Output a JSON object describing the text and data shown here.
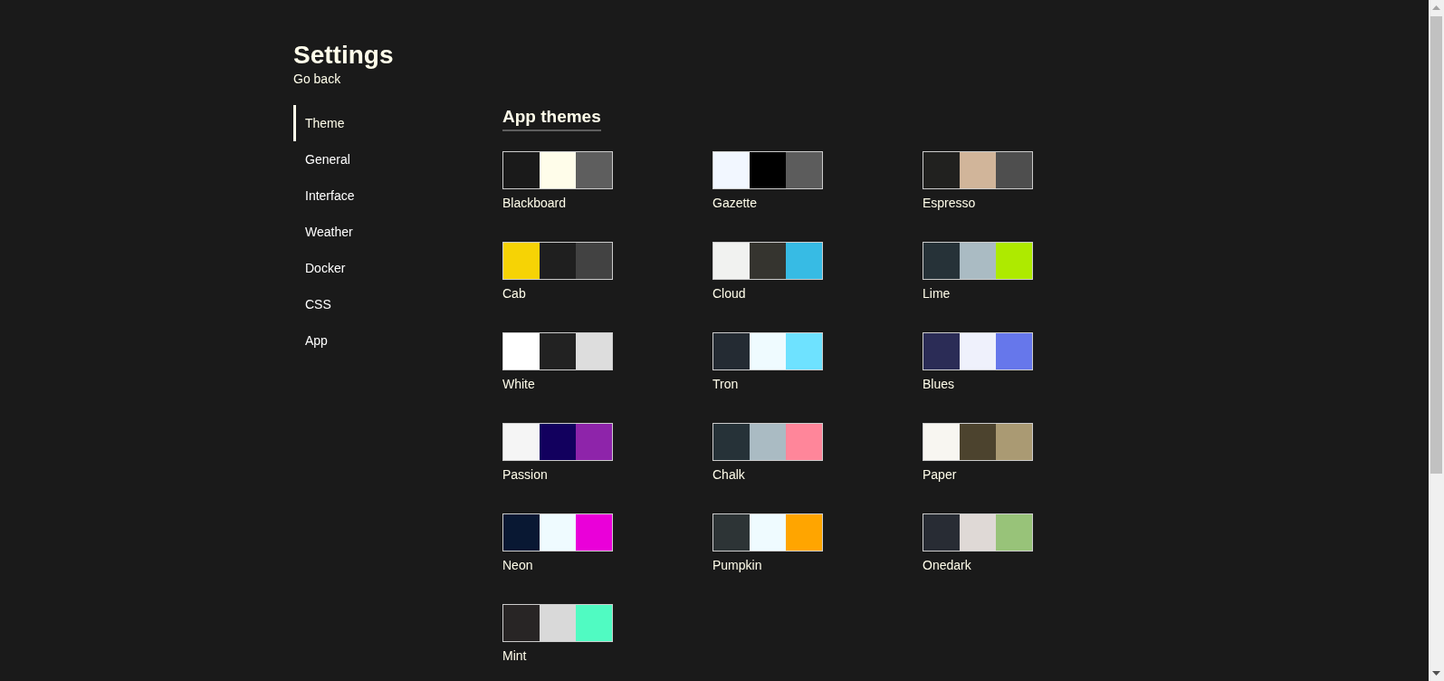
{
  "header": {
    "title": "Settings",
    "back_link": "Go back"
  },
  "sidebar": {
    "items": [
      {
        "label": "Theme",
        "selected": true
      },
      {
        "label": "General",
        "selected": false
      },
      {
        "label": "Interface",
        "selected": false
      },
      {
        "label": "Weather",
        "selected": false
      },
      {
        "label": "Docker",
        "selected": false
      },
      {
        "label": "CSS",
        "selected": false
      },
      {
        "label": "App",
        "selected": false
      }
    ]
  },
  "section": {
    "title": "App themes",
    "themes": [
      {
        "name": "Blackboard",
        "swatches": [
          {
            "color": "#1a1a1a"
          },
          {
            "color": "#fffdea"
          },
          {
            "color": "#5e5e5e"
          }
        ]
      },
      {
        "name": "Gazette",
        "swatches": [
          {
            "color": "#f2f7ff"
          },
          {
            "color": "#000000"
          },
          {
            "color": "#5c5c5c"
          }
        ]
      },
      {
        "name": "Espresso",
        "swatches": [
          {
            "color": "#21211f"
          },
          {
            "color": "#d1b59a"
          },
          {
            "color": "#4e4e4e"
          }
        ]
      },
      {
        "name": "Cab",
        "swatches": [
          {
            "color": "#f6d305"
          },
          {
            "color": "#1f1f1f"
          },
          {
            "color": "#424242"
          }
        ]
      },
      {
        "name": "Cloud",
        "swatches": [
          {
            "color": "#f1f2f0"
          },
          {
            "color": "#35342f"
          },
          {
            "color": "#37bbe4"
          }
        ]
      },
      {
        "name": "Lime",
        "swatches": [
          {
            "color": "#263238"
          },
          {
            "color": "#aabbc3"
          },
          {
            "color": "#aeea00"
          }
        ]
      },
      {
        "name": "White",
        "swatches": [
          {
            "color": "#ffffff"
          },
          {
            "color": "#222222"
          },
          {
            "color": "#dddddd"
          }
        ]
      },
      {
        "name": "Tron",
        "swatches": [
          {
            "color": "#242b33"
          },
          {
            "color": "#effbff"
          },
          {
            "color": "#6ee2ff"
          }
        ]
      },
      {
        "name": "Blues",
        "swatches": [
          {
            "color": "#2b2c56"
          },
          {
            "color": "#eff1fc"
          },
          {
            "color": "#6677eb"
          }
        ]
      },
      {
        "name": "Passion",
        "swatches": [
          {
            "color": "#f5f5f5"
          },
          {
            "color": "#12005e"
          },
          {
            "color": "#8e24aa"
          }
        ]
      },
      {
        "name": "Chalk",
        "swatches": [
          {
            "color": "#263238"
          },
          {
            "color": "#aabbc3"
          },
          {
            "color": "#ff869a"
          }
        ]
      },
      {
        "name": "Paper",
        "swatches": [
          {
            "color": "#f8f6f1"
          },
          {
            "color": "#4c432e"
          },
          {
            "color": "#aa9a73"
          }
        ]
      },
      {
        "name": "Neon",
        "swatches": [
          {
            "color": "#091833"
          },
          {
            "color": "#effbff"
          },
          {
            "color": "#ea00d9"
          }
        ]
      },
      {
        "name": "Pumpkin",
        "swatches": [
          {
            "color": "#2d3436"
          },
          {
            "color": "#effbff"
          },
          {
            "color": "#ffa500"
          }
        ]
      },
      {
        "name": "Onedark",
        "swatches": [
          {
            "color": "#282c34"
          },
          {
            "color": "#dfd9d6"
          },
          {
            "color": "#98c379"
          }
        ]
      },
      {
        "name": "Mint",
        "swatches": [
          {
            "color": "#282525"
          },
          {
            "color": "#d9d9d9"
          },
          {
            "color": "#50fbc2"
          }
        ]
      }
    ]
  }
}
